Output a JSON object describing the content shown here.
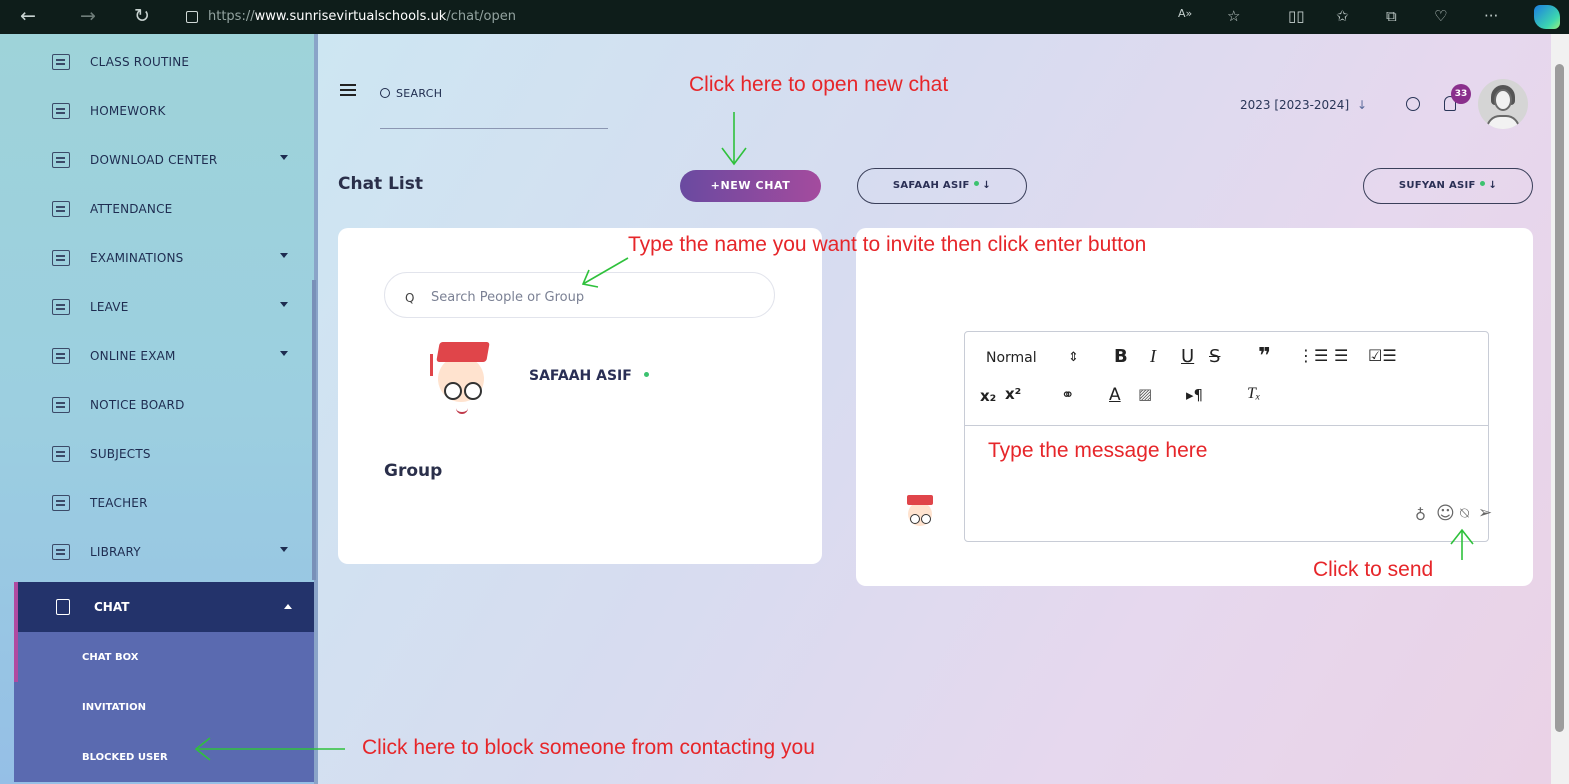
{
  "browser": {
    "url_prefix": "https://",
    "url_domain": "www.sunrisevirtualschools.uk",
    "url_path": "/chat/open",
    "icons": [
      "back-icon",
      "forward-icon",
      "refresh-icon",
      "site-info-icon",
      "read-aloud-icon",
      "favorite-icon",
      "split-screen-icon",
      "favorites-icon",
      "collections-icon",
      "performance-icon",
      "more-icon",
      "copilot-icon"
    ]
  },
  "sidebar": {
    "items": [
      {
        "label": "CLASS ROUTINE",
        "caret": false
      },
      {
        "label": "HOMEWORK",
        "caret": false
      },
      {
        "label": "DOWNLOAD CENTER",
        "caret": true
      },
      {
        "label": "ATTENDANCE",
        "caret": false
      },
      {
        "label": "EXAMINATIONS",
        "caret": true
      },
      {
        "label": "LEAVE",
        "caret": true
      },
      {
        "label": "ONLINE EXAM",
        "caret": true
      },
      {
        "label": "NOTICE BOARD",
        "caret": false
      },
      {
        "label": "SUBJECTS",
        "caret": false
      },
      {
        "label": "TEACHER",
        "caret": false
      },
      {
        "label": "LIBRARY",
        "caret": true
      }
    ],
    "active": {
      "label": "CHAT"
    },
    "sub_items": [
      "CHAT BOX",
      "INVITATION",
      "BLOCKED USER"
    ]
  },
  "header": {
    "search_label": "SEARCH",
    "year": "2023 [2023-2024]",
    "year_arrow": "↓",
    "notification_count": "33"
  },
  "chat": {
    "title": "Chat List",
    "new_chat_label": "+NEW CHAT",
    "people_search_placeholder": "Search People or Group",
    "contact_name": "SAFAAH ASIF",
    "group_label": "Group",
    "tab_left": "SAFAAH ASIF",
    "tab_right": "SUFYAN ASIF",
    "tab_arrow": "↓"
  },
  "editor": {
    "format_select": "Normal",
    "toolbar_row1": [
      "B",
      "I",
      "U",
      "S",
      "❞",
      "ordered-list",
      "bullet-list",
      "check-list"
    ],
    "toolbar_row2": [
      "subscript",
      "superscript",
      "link",
      "A",
      "background",
      "text-direction",
      "clear-format"
    ]
  },
  "annotations": {
    "new_chat": "Click here to open new chat",
    "invite": "Type the name you want to invite then click enter button",
    "message": "Type the message here",
    "send": "Click to send",
    "block": "Click here to block someone from contacting you"
  },
  "colors": {
    "annotation": "#e6262a",
    "arrow": "#2fc13c",
    "sidebar_active": "#23336b",
    "sidebar_sub": "#5a6ab0",
    "new_chat_gradient_start": "#6a4aa0",
    "new_chat_gradient_end": "#a44b9e",
    "online_dot": "#3cc26f",
    "badge": "#8a2f8c"
  }
}
